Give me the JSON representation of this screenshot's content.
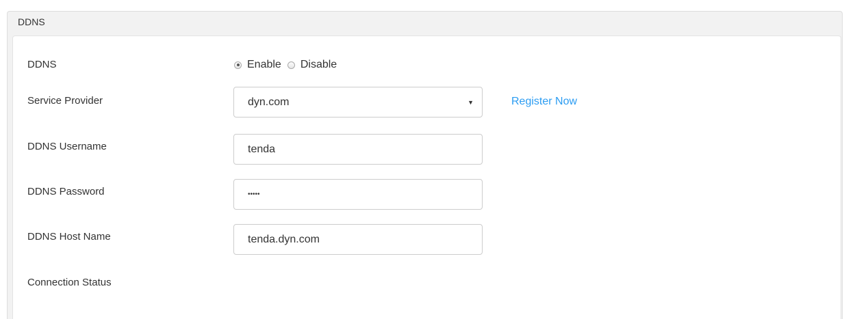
{
  "panel": {
    "title": "DDNS"
  },
  "ddns": {
    "label": "DDNS",
    "options": [
      {
        "label": "Enable",
        "checked": true
      },
      {
        "label": "Disable",
        "checked": false
      }
    ]
  },
  "service_provider": {
    "label": "Service Provider",
    "value": "dyn.com",
    "register_link": "Register Now"
  },
  "username": {
    "label": "DDNS Username",
    "value": "tenda"
  },
  "password": {
    "label": "DDNS Password",
    "value": "•••••"
  },
  "hostname": {
    "label": "DDNS Host Name",
    "value": "tenda.dyn.com"
  },
  "connection_status": {
    "label": "Connection Status",
    "value": ""
  },
  "colors": {
    "link": "#2b9cf2",
    "panel_bg": "#f2f2f2",
    "border": "#cccccc"
  }
}
